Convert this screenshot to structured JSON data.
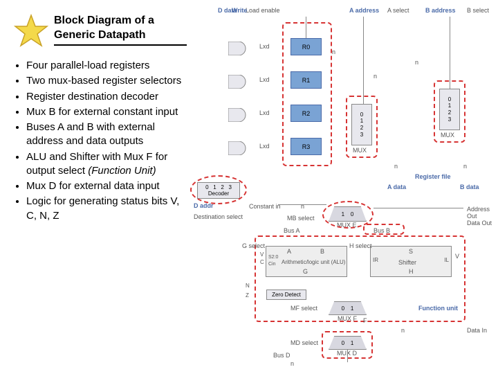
{
  "title": "Block Diagram of a Generic Datapath",
  "bullets": [
    "Four parallel-load registers",
    "Two mux-based register selectors",
    "Register destination decoder",
    "Mux B for external constant input",
    "Buses A and B with external address and data outputs",
    "ALU and Shifter with Mux F for output select (Function Unit)",
    "Mux D for external data input",
    "Logic for generating status bits V, C, N, Z"
  ],
  "bullet_italic_part": "(Function Unit)",
  "diagram": {
    "top_labels": {
      "load_enable": "Load enable",
      "write": "Write",
      "d_data": "D data",
      "a_address": "A address",
      "a_select": "A select",
      "b_address": "B address",
      "b_select": "B select"
    },
    "registers": [
      "R0",
      "R1",
      "R2",
      "R3"
    ],
    "load_labels": [
      "Lxd",
      "Lxd",
      "Lxd",
      "Lxd"
    ],
    "mux_a": {
      "label": "MUX",
      "ports": "0\n1\n2\n3"
    },
    "mux_b_sel": {
      "label": "MUX",
      "ports": "0\n1\n2\n3"
    },
    "decoder": {
      "label": "Decoder",
      "ports": "0   1   2   3"
    },
    "side_labels": {
      "d_addr": "D addr",
      "dest_select": "Destination select",
      "const_in": "Constant in",
      "mb_select": "MB select",
      "bus_a": "Bus A",
      "bus_b": "Bus B",
      "register_file": "Register file",
      "a_data": "A data",
      "b_data": "B data",
      "n_wire": "n"
    },
    "mux_e": {
      "label": "MUX E",
      "ports": "1    0"
    },
    "outputs": {
      "addr_out": "Address Out",
      "data_out": "Data Out"
    },
    "funit": {
      "g_select": "G select",
      "h_select": "H select",
      "a": "A",
      "b": "B",
      "s": "S",
      "alu": "Arithmetic/logic unit (ALU)",
      "shifter": "Shifter",
      "ir": "IR",
      "il": "IL",
      "g": "G",
      "h": "H",
      "s20": "S2:0",
      "cin": "Cin",
      "status": [
        "V",
        "C",
        "N",
        "Z"
      ],
      "zero_detect": "Zero Detect",
      "mf_select": "MF select",
      "mux_f": {
        "label": "MUX F",
        "ports": "0    1"
      },
      "f": "F",
      "function_unit": "Function unit"
    },
    "md_select": "MD select",
    "mux_d": {
      "label": "MUX D",
      "ports": "0    1"
    },
    "bus_d": "Bus D",
    "data_in": "Data In"
  }
}
